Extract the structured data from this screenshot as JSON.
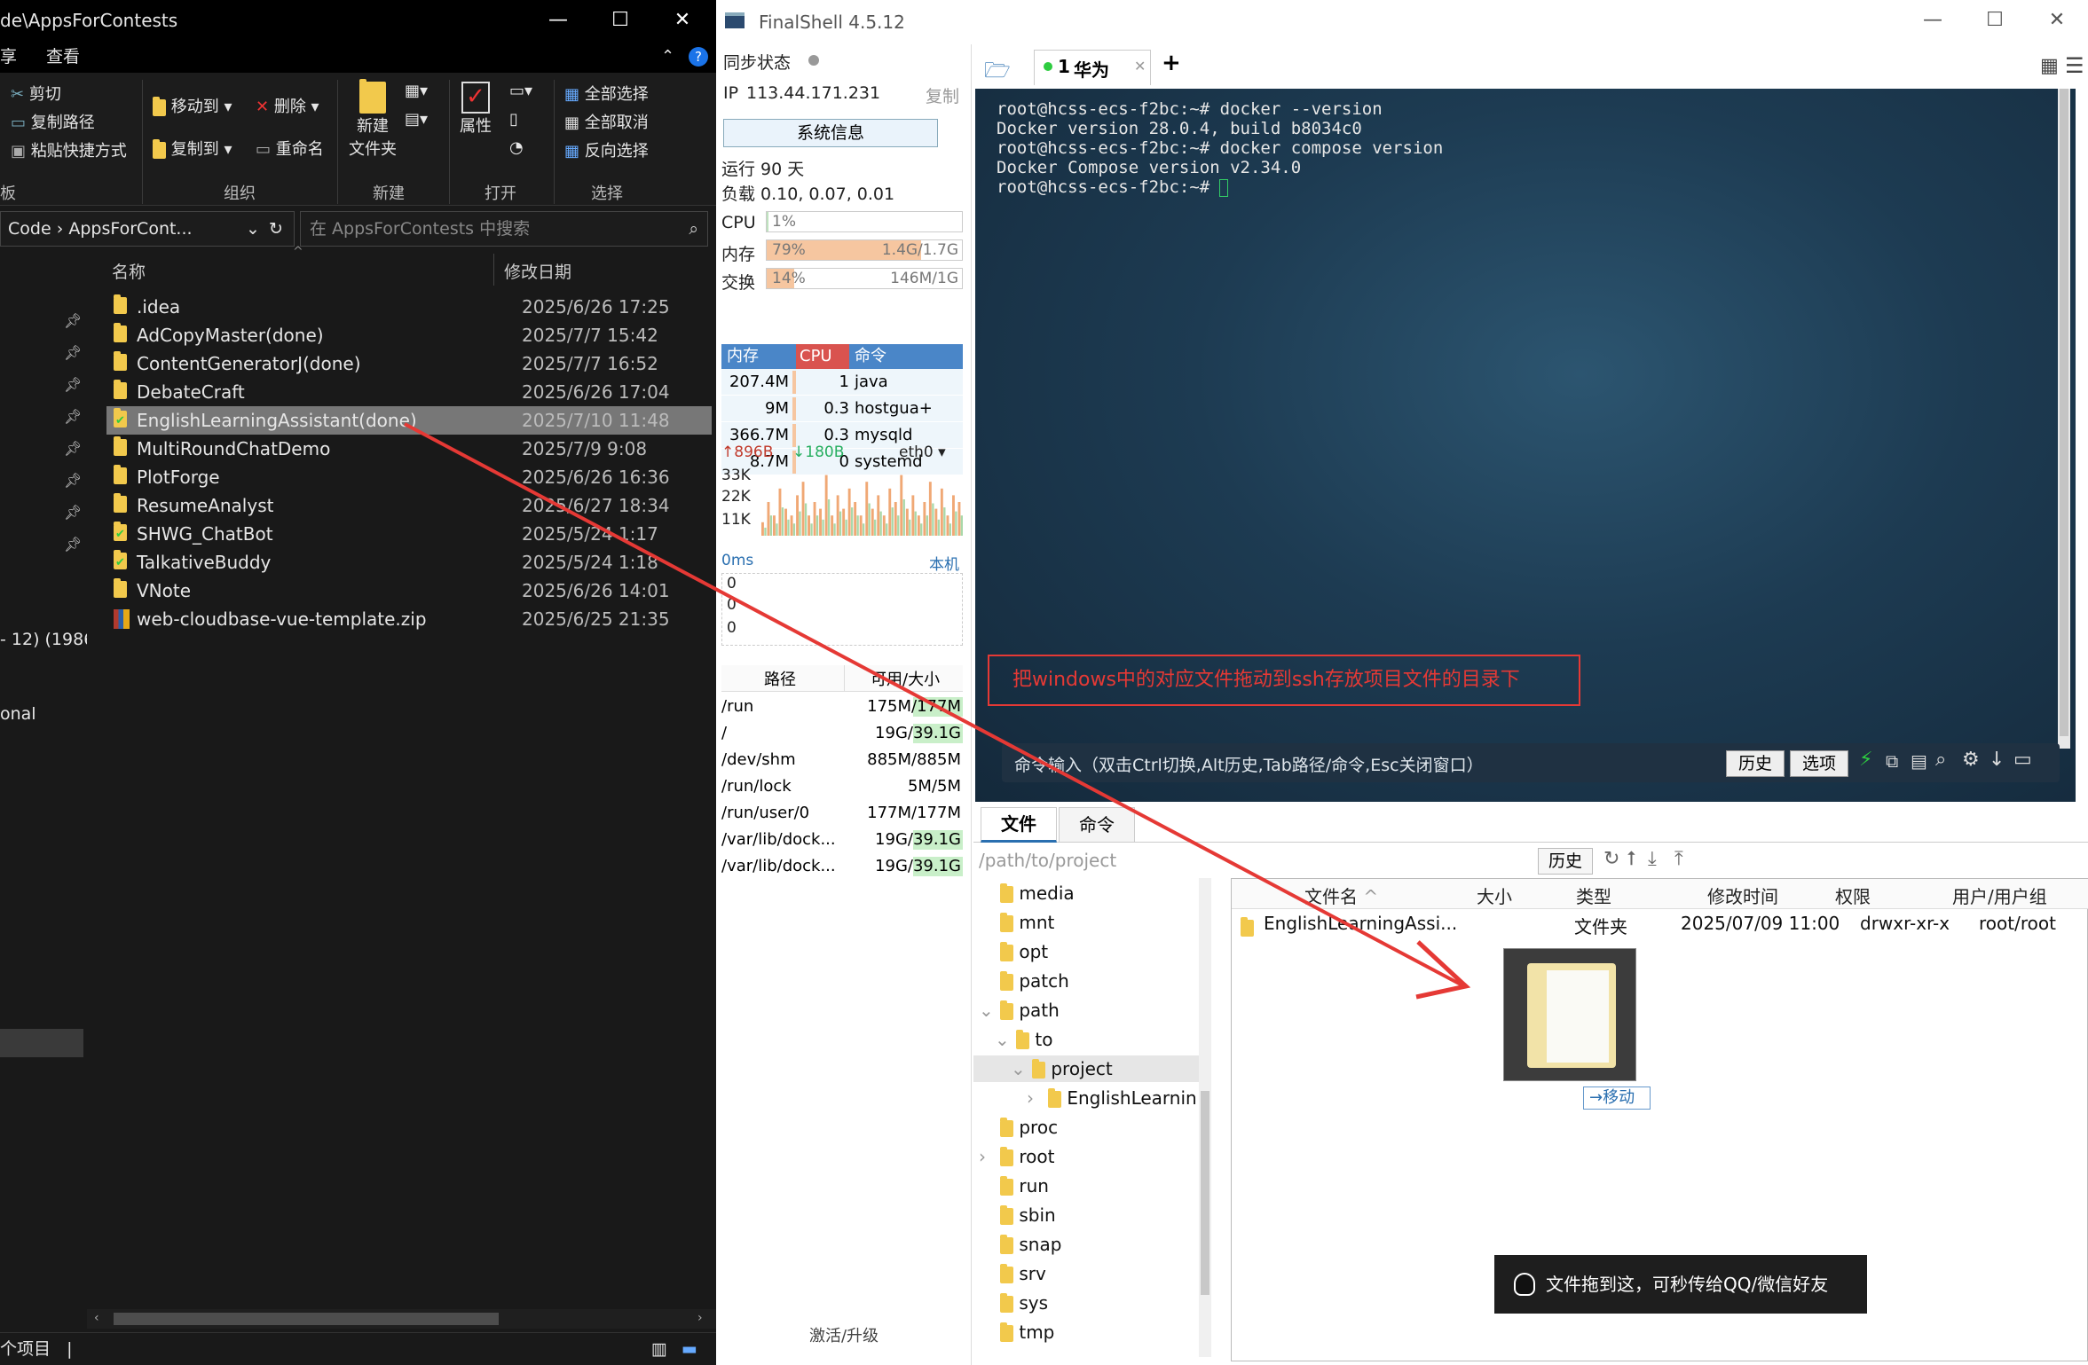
{
  "explorer": {
    "title": "de\\AppsForContests",
    "menu": {
      "share": "享",
      "view": "查看"
    },
    "ribbon": {
      "cut": "剪切",
      "copy_path": "复制路径",
      "paste_shortcut": "粘贴快捷方式",
      "move_to": "移动到",
      "delete": "删除",
      "copy_to": "复制到",
      "rename": "重命名",
      "new_folder_l1": "新建",
      "new_folder_l2": "文件夹",
      "properties": "属性",
      "select_all": "全部选择",
      "select_none": "全部取消",
      "invert_select": "反向选择",
      "group_partial": "板",
      "group_organize": "组织",
      "group_new": "新建",
      "group_open": "打开",
      "group_select": "选择"
    },
    "address": {
      "seg1": "Code",
      "seg2": "AppsForCont..."
    },
    "search_placeholder": "在 AppsForContests 中搜索",
    "columns": {
      "name": "名称",
      "modified": "修改日期"
    },
    "files": [
      {
        "name": ".idea",
        "date": "2025/6/26 17:25",
        "icon": "folder-icon"
      },
      {
        "name": "AdCopyMaster(done)",
        "date": "2025/7/7 15:42",
        "icon": "folder-icon"
      },
      {
        "name": "ContentGeneratorJ(done)",
        "date": "2025/7/7 16:52",
        "icon": "folder-icon"
      },
      {
        "name": "DebateCraft",
        "date": "2025/6/26 17:04",
        "icon": "folder-icon"
      },
      {
        "name": "EnglishLearningAssistant(done)",
        "date": "2025/7/10 11:48",
        "icon": "folder-sync-icon"
      },
      {
        "name": "MultiRoundChatDemo",
        "date": "2025/7/9 9:08",
        "icon": "folder-icon"
      },
      {
        "name": "PlotForge",
        "date": "2025/6/26 16:36",
        "icon": "folder-icon"
      },
      {
        "name": "ResumeAnalyst",
        "date": "2025/6/27 18:34",
        "icon": "folder-icon"
      },
      {
        "name": "SHWG_ChatBot",
        "date": "2025/5/24 1:17",
        "icon": "folder-sync-icon"
      },
      {
        "name": "TalkativeBuddy",
        "date": "2025/5/24 1:18",
        "icon": "folder-sync-icon"
      },
      {
        "name": "VNote",
        "date": "2025/6/26 14:01",
        "icon": "folder-icon"
      },
      {
        "name": "web-cloudbase-vue-template.zip",
        "date": "2025/6/25 21:35",
        "icon": "zip-icon"
      }
    ],
    "nav_fragments": {
      "a": "- 12) (1986",
      "b": "onal"
    },
    "status": "个项目"
  },
  "finalshell": {
    "title": "FinalShell 4.5.12",
    "sync_label": "同步状态",
    "ip_label": "IP",
    "ip": "113.44.171.231",
    "copy": "复制",
    "sysinfo": "系统信息",
    "uptime": "运行 90 天",
    "load": "负载 0.10, 0.07, 0.01",
    "cpu": {
      "label": "CPU",
      "value": "1%",
      "fraction": 0.01
    },
    "mem": {
      "label": "内存",
      "value": "79%",
      "size": "1.4G/1.7G",
      "fraction": 0.79
    },
    "swap": {
      "label": "交换",
      "value": "14%",
      "size": "146M/1G",
      "fraction": 0.14
    },
    "proc_headers": {
      "mem": "内存",
      "cpu": "CPU",
      "cmd": "命令"
    },
    "processes": [
      {
        "mem": "207.4M",
        "cpu": "1",
        "cmd": "java"
      },
      {
        "mem": "9M",
        "cpu": "0.3",
        "cmd": "hostgua+"
      },
      {
        "mem": "366.7M",
        "cpu": "0.3",
        "cmd": "mysqld"
      },
      {
        "mem": "8.7M",
        "cpu": "0",
        "cmd": "systemd"
      }
    ],
    "net": {
      "up": "896B",
      "down": "180B",
      "iface": "eth0",
      "y1": "33K",
      "y2": "22K",
      "y3": "11K"
    },
    "net_bars": [
      0.2,
      0.5,
      0.3,
      0.7,
      0.4,
      0.3,
      0.6,
      0.8,
      0.3,
      0.5,
      0.4,
      0.9,
      0.3,
      0.6,
      0.4,
      0.7,
      0.5,
      0.3,
      0.8,
      0.4,
      0.6,
      0.3,
      0.7,
      0.5,
      0.9,
      0.4,
      0.6,
      0.3,
      0.5,
      0.8,
      0.4,
      0.7,
      0.3,
      0.6,
      0.5
    ],
    "ping": {
      "label": "0ms",
      "host": "本机",
      "v1": "0",
      "v2": "0",
      "v3": "0"
    },
    "disk_headers": {
      "path": "路径",
      "avail": "可用/大小"
    },
    "disks": [
      {
        "path": "/run",
        "avail": "175M/177M"
      },
      {
        "path": "/",
        "avail": "19G/39.1G"
      },
      {
        "path": "/dev/shm",
        "avail": "885M/885M"
      },
      {
        "path": "/run/lock",
        "avail": "5M/5M"
      },
      {
        "path": "/run/user/0",
        "avail": "177M/177M"
      },
      {
        "path": "/var/lib/dock...",
        "avail": "19G/39.1G"
      },
      {
        "path": "/var/lib/dock...",
        "avail": "19G/39.1G"
      }
    ],
    "activate": "激活/升级",
    "tab": {
      "index": "1",
      "name": "华为"
    },
    "terminal": [
      "root@hcss-ecs-f2bc:~# docker --version",
      "Docker version 28.0.4, build b8034c0",
      "root@hcss-ecs-f2bc:~# docker compose version",
      "Docker Compose version v2.34.0",
      "root@hcss-ecs-f2bc:~# "
    ],
    "annotation": "把windows中的对应文件拖动到ssh存放项目文件的目录下",
    "cmd_hint": "命令输入（双击Ctrl切换,Alt历史,Tab路径/命令,Esc关闭窗口）",
    "history": "历史",
    "options": "选项",
    "file_tabs": {
      "files": "文件",
      "commands": "命令"
    },
    "path": "/path/to/project",
    "path_history": "历史",
    "tree": [
      "media",
      "mnt",
      "opt",
      "patch",
      "path",
      "to",
      "project",
      "EnglishLearnin",
      "proc",
      "root",
      "run",
      "sbin",
      "snap",
      "srv",
      "sys",
      "tmp"
    ],
    "file_headers": {
      "name": "文件名",
      "size": "大小",
      "type": "类型",
      "mtime": "修改时间",
      "perm": "权限",
      "owner": "用户/用户组"
    },
    "remote_file": {
      "name": "EnglishLearningAssi...",
      "type": "文件夹",
      "mtime": "2025/07/09 11:00",
      "perm": "drwxr-xr-x",
      "owner": "root/root"
    },
    "drag_label": "移动",
    "qq_tip": "文件拖到这，可秒传给QQ/微信好友"
  }
}
